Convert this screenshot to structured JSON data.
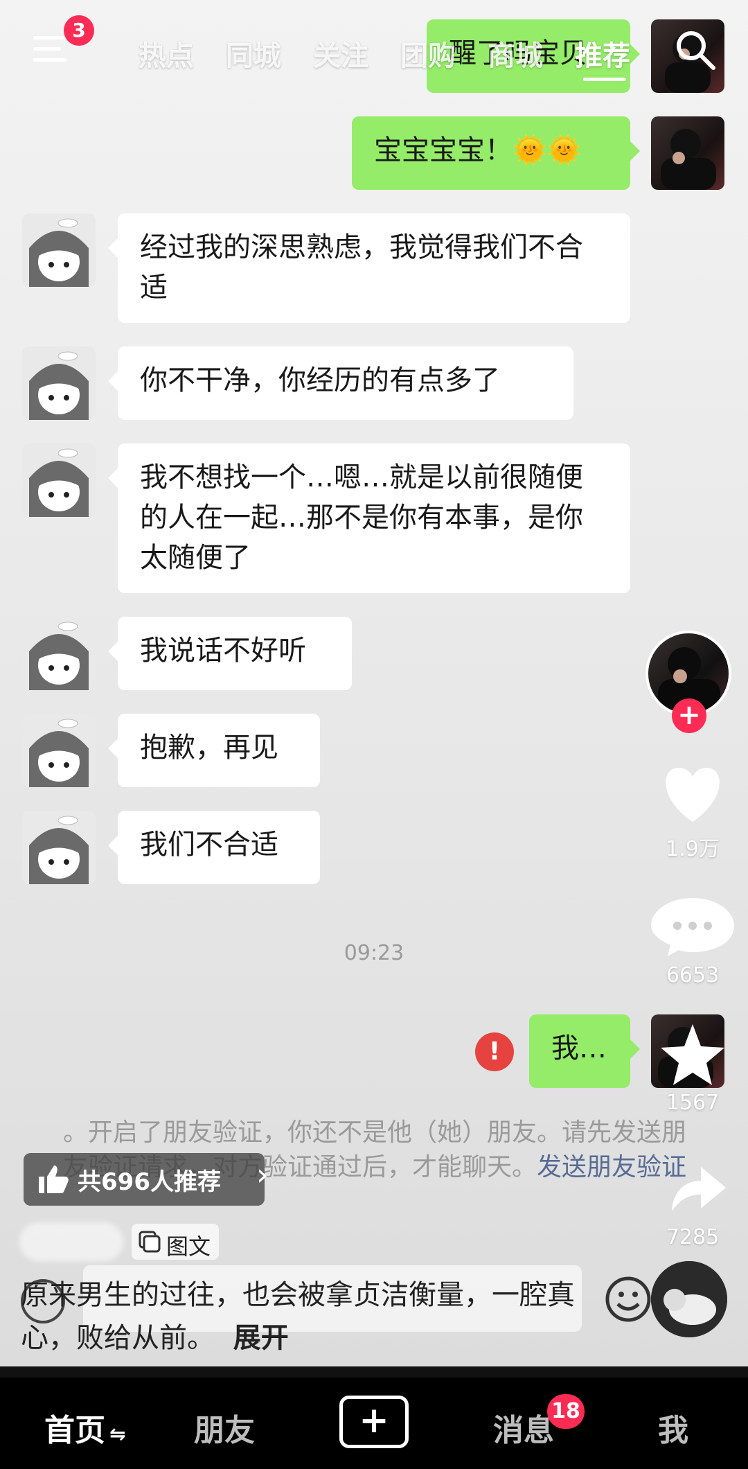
{
  "top_nav": {
    "menu_badge": "3",
    "tabs": [
      "热点",
      "同城",
      "关注",
      "团购",
      "商城",
      "推荐"
    ]
  },
  "chat": {
    "messages_right_top": [
      {
        "text": "醒了吗宝贝"
      },
      {
        "text": "宝宝宝宝！🌞🌞"
      }
    ],
    "messages_left": [
      {
        "text": "经过我的深思熟虑，我觉得我们不合适"
      },
      {
        "text": "你不干净，你经历的有点多了"
      },
      {
        "text": "我不想找一个…嗯…就是以前很随便的人在一起…那不是你有本事，是你太随便了"
      },
      {
        "text": "我说话不好听"
      },
      {
        "text": "抱歉，再见"
      },
      {
        "text": "我们不合适"
      }
    ],
    "timestamp": "09:23",
    "message_failed": {
      "text": "我…",
      "error_mark": "!"
    },
    "system_notice": "。开启了朋友验证，你还不是他（她）朋友。请先发送朋友验证请求，对方验证通过后，才能聊天。",
    "system_notice_link": "发送朋友验证"
  },
  "actions": {
    "follow_plus": "+",
    "likes": "1.9万",
    "comments": "6653",
    "favorites": "1567",
    "shares": "7285"
  },
  "recommend_pill": {
    "label": "共696人推荐",
    "chevron": "›"
  },
  "post": {
    "type_tag": "图文",
    "caption": "原来男生的过往，也会被拿贞洁衡量，一腔真心，败给从前。",
    "expand_label": "展开"
  },
  "bottom_nav": {
    "home": "首页",
    "friends": "朋友",
    "create": "+",
    "messages": "消息",
    "messages_badge": "18",
    "me": "我"
  },
  "colors": {
    "accent_red": "#fe2c55",
    "chat_green": "#95ec69",
    "error_red": "#e64340",
    "link_blue": "#576b95"
  }
}
